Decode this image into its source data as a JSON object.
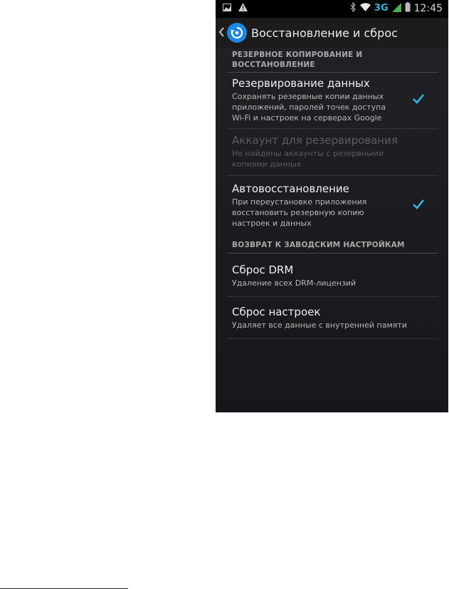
{
  "status_bar": {
    "left_icons": [
      "image-icon",
      "warning-icon"
    ],
    "right_icons": [
      "bluetooth-icon",
      "wifi-icon",
      "signal-icon",
      "battery-icon"
    ],
    "network": "3G",
    "time": "12:45"
  },
  "action_bar": {
    "title": "Восстановление и сброс",
    "icon": "backup-restore-icon"
  },
  "sections": [
    {
      "header": "РЕЗЕРВНОЕ КОПИРОВАНИЕ И ВОССТАНОВЛЕНИЕ",
      "header_line1": "РЕЗЕРВНОЕ КОПИРОВАНИЕ И",
      "header_line2": "ВОССТАНОВЛЕНИЕ"
    },
    {
      "header": "ВОЗВРАТ К ЗАВОДСКИМ НАСТРОЙКАМ"
    }
  ],
  "prefs": [
    {
      "title": "Резервирование данных",
      "summary_l1": "Сохранять резервные копии данных",
      "summary_l2": "приложений, паролей точек доступа",
      "summary_l3": "Wi-Fi и настроек на серверах Google",
      "checked": true,
      "enabled": true
    },
    {
      "title": "Аккаунт для резервирования",
      "summary_l1": "Не найдены аккаунты с резервными",
      "summary_l2": "копиями данных",
      "enabled": false
    },
    {
      "title": "Автовосстановление",
      "summary_l1": "При переустановке приложения",
      "summary_l2": "восстановить резервную копию",
      "summary_l3": "настроек и данных",
      "checked": true,
      "enabled": true
    },
    {
      "title": "Сброс DRM",
      "summary_l1": "Удаление всех DRM-лицензий",
      "enabled": true
    },
    {
      "title": "Сброс настроек",
      "summary_l1": "Удаляет все данные с внутренней памяти",
      "enabled": true
    }
  ],
  "colors": {
    "accent": "#33b5e5",
    "background": "#1b1d20",
    "status_bar": "#000000"
  }
}
